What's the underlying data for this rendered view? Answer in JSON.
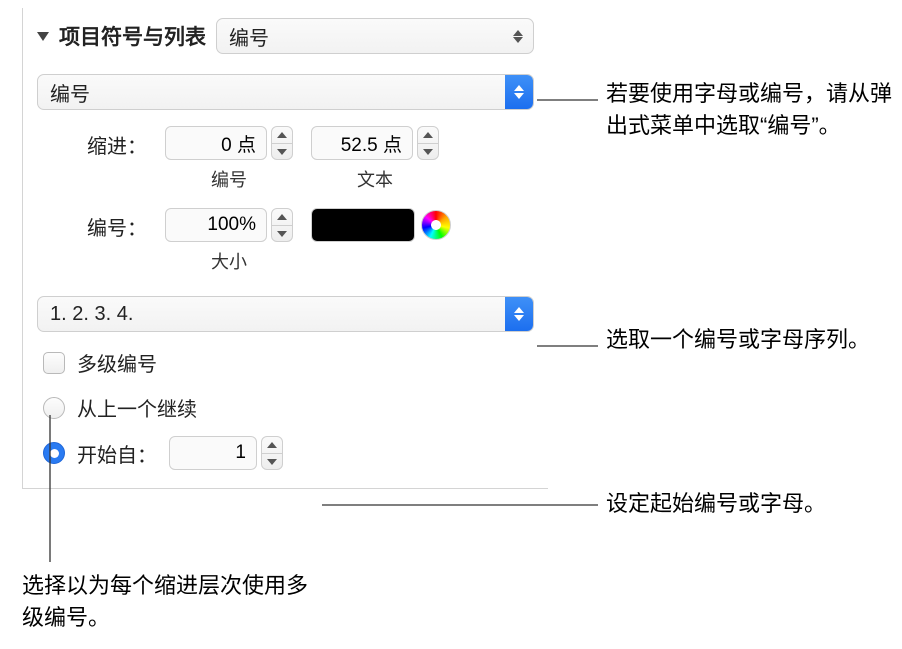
{
  "header": {
    "title": "项目符号与列表",
    "style_popup": "编号"
  },
  "format_popup": "编号",
  "indent": {
    "label": "缩进：",
    "number_value": "0 点",
    "number_sublabel": "编号",
    "text_value": "52.5 点",
    "text_sublabel": "文本"
  },
  "number": {
    "label": "编号：",
    "size_value": "100%",
    "size_sublabel": "大小"
  },
  "sequence_popup": "1. 2. 3. 4.",
  "tiered": {
    "label": "多级编号",
    "checked": false
  },
  "continue": {
    "label": "从上一个继续",
    "selected": false
  },
  "start": {
    "label": "开始自：",
    "value": "1",
    "selected": true
  },
  "callouts": {
    "c1": "若要使用字母或编号，请从弹出式菜单中选取“编号”。",
    "c2": "选取一个编号或字母序列。",
    "c3": "设定起始编号或字母。",
    "c4": "选择以为每个缩进层次使用多级编号。"
  }
}
